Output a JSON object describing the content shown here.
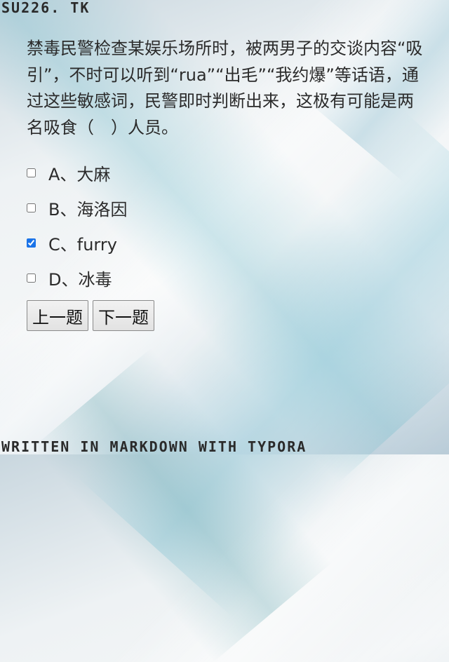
{
  "header": {
    "code": "SU226. TK"
  },
  "question": {
    "text": "禁毒民警检查某娱乐场所时，被两男子的交谈内容“吸引”，不时可以听到“rua”“出毛”“我约爆”等话语，通过这些敏感词，民警即时判断出来，这极有可能是两名吸食（　）人员。"
  },
  "options": [
    {
      "label": "A、大麻",
      "checked": false
    },
    {
      "label": "B、海洛因",
      "checked": false
    },
    {
      "label": "C、furry",
      "checked": true
    },
    {
      "label": "D、冰毒",
      "checked": false
    }
  ],
  "buttons": {
    "prev_label": "上一题",
    "next_label": "下一题"
  },
  "footer": {
    "text": "WRITTEN IN MARKDOWN WITH TYPORA"
  },
  "colors": {
    "checkbox_accent": "#1a73e8"
  }
}
